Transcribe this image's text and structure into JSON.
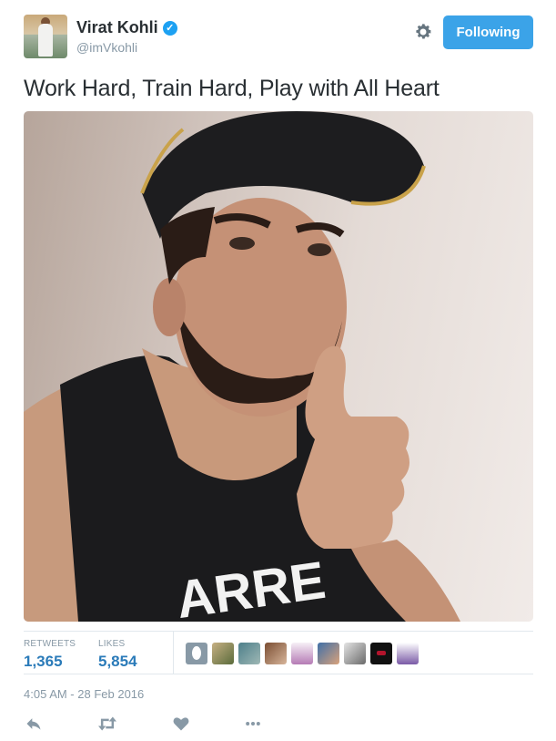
{
  "user": {
    "name": "Virat Kohli",
    "handle": "@imVkohli",
    "verified_icon": "verified-badge-icon",
    "avatar": "profile-avatar"
  },
  "header": {
    "settings_icon": "gear-icon",
    "follow_button_label": "Following",
    "accent_color": "#3ba3e8"
  },
  "tweet": {
    "text": "Work Hard, Train Hard, Play with All Heart",
    "media": "photo of man in cap giving thumbs up"
  },
  "stats": {
    "retweets_label": "RETWEETS",
    "retweets_value": "1,365",
    "likes_label": "LIKES",
    "likes_value": "5,854",
    "liker_avatars": 9
  },
  "timestamp": "4:05 AM - 28 Feb 2016",
  "actions": {
    "reply_icon": "reply-icon",
    "retweet_icon": "retweet-icon",
    "like_icon": "heart-icon",
    "more_icon": "more-dots-icon"
  }
}
